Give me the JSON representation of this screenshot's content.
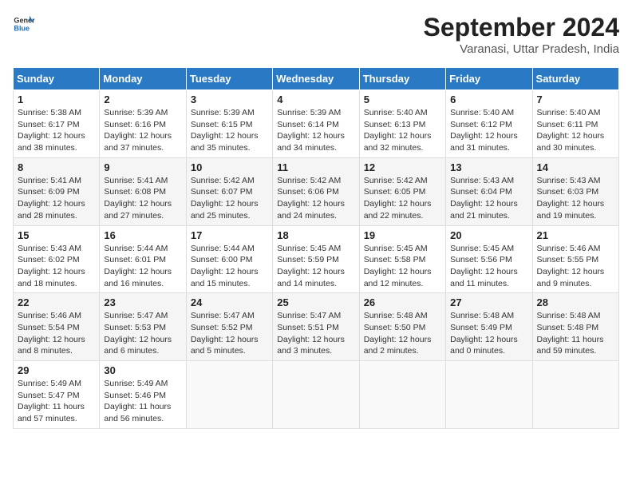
{
  "header": {
    "logo_line1": "General",
    "logo_line2": "Blue",
    "title": "September 2024",
    "subtitle": "Varanasi, Uttar Pradesh, India"
  },
  "calendar": {
    "days_of_week": [
      "Sunday",
      "Monday",
      "Tuesday",
      "Wednesday",
      "Thursday",
      "Friday",
      "Saturday"
    ],
    "weeks": [
      [
        {
          "day": "",
          "detail": ""
        },
        {
          "day": "2",
          "detail": "Sunrise: 5:39 AM\nSunset: 6:16 PM\nDaylight: 12 hours\nand 37 minutes."
        },
        {
          "day": "3",
          "detail": "Sunrise: 5:39 AM\nSunset: 6:15 PM\nDaylight: 12 hours\nand 35 minutes."
        },
        {
          "day": "4",
          "detail": "Sunrise: 5:39 AM\nSunset: 6:14 PM\nDaylight: 12 hours\nand 34 minutes."
        },
        {
          "day": "5",
          "detail": "Sunrise: 5:40 AM\nSunset: 6:13 PM\nDaylight: 12 hours\nand 32 minutes."
        },
        {
          "day": "6",
          "detail": "Sunrise: 5:40 AM\nSunset: 6:12 PM\nDaylight: 12 hours\nand 31 minutes."
        },
        {
          "day": "7",
          "detail": "Sunrise: 5:40 AM\nSunset: 6:11 PM\nDaylight: 12 hours\nand 30 minutes."
        }
      ],
      [
        {
          "day": "8",
          "detail": "Sunrise: 5:41 AM\nSunset: 6:09 PM\nDaylight: 12 hours\nand 28 minutes."
        },
        {
          "day": "9",
          "detail": "Sunrise: 5:41 AM\nSunset: 6:08 PM\nDaylight: 12 hours\nand 27 minutes."
        },
        {
          "day": "10",
          "detail": "Sunrise: 5:42 AM\nSunset: 6:07 PM\nDaylight: 12 hours\nand 25 minutes."
        },
        {
          "day": "11",
          "detail": "Sunrise: 5:42 AM\nSunset: 6:06 PM\nDaylight: 12 hours\nand 24 minutes."
        },
        {
          "day": "12",
          "detail": "Sunrise: 5:42 AM\nSunset: 6:05 PM\nDaylight: 12 hours\nand 22 minutes."
        },
        {
          "day": "13",
          "detail": "Sunrise: 5:43 AM\nSunset: 6:04 PM\nDaylight: 12 hours\nand 21 minutes."
        },
        {
          "day": "14",
          "detail": "Sunrise: 5:43 AM\nSunset: 6:03 PM\nDaylight: 12 hours\nand 19 minutes."
        }
      ],
      [
        {
          "day": "15",
          "detail": "Sunrise: 5:43 AM\nSunset: 6:02 PM\nDaylight: 12 hours\nand 18 minutes."
        },
        {
          "day": "16",
          "detail": "Sunrise: 5:44 AM\nSunset: 6:01 PM\nDaylight: 12 hours\nand 16 minutes."
        },
        {
          "day": "17",
          "detail": "Sunrise: 5:44 AM\nSunset: 6:00 PM\nDaylight: 12 hours\nand 15 minutes."
        },
        {
          "day": "18",
          "detail": "Sunrise: 5:45 AM\nSunset: 5:59 PM\nDaylight: 12 hours\nand 14 minutes."
        },
        {
          "day": "19",
          "detail": "Sunrise: 5:45 AM\nSunset: 5:58 PM\nDaylight: 12 hours\nand 12 minutes."
        },
        {
          "day": "20",
          "detail": "Sunrise: 5:45 AM\nSunset: 5:56 PM\nDaylight: 12 hours\nand 11 minutes."
        },
        {
          "day": "21",
          "detail": "Sunrise: 5:46 AM\nSunset: 5:55 PM\nDaylight: 12 hours\nand 9 minutes."
        }
      ],
      [
        {
          "day": "22",
          "detail": "Sunrise: 5:46 AM\nSunset: 5:54 PM\nDaylight: 12 hours\nand 8 minutes."
        },
        {
          "day": "23",
          "detail": "Sunrise: 5:47 AM\nSunset: 5:53 PM\nDaylight: 12 hours\nand 6 minutes."
        },
        {
          "day": "24",
          "detail": "Sunrise: 5:47 AM\nSunset: 5:52 PM\nDaylight: 12 hours\nand 5 minutes."
        },
        {
          "day": "25",
          "detail": "Sunrise: 5:47 AM\nSunset: 5:51 PM\nDaylight: 12 hours\nand 3 minutes."
        },
        {
          "day": "26",
          "detail": "Sunrise: 5:48 AM\nSunset: 5:50 PM\nDaylight: 12 hours\nand 2 minutes."
        },
        {
          "day": "27",
          "detail": "Sunrise: 5:48 AM\nSunset: 5:49 PM\nDaylight: 12 hours\nand 0 minutes."
        },
        {
          "day": "28",
          "detail": "Sunrise: 5:48 AM\nSunset: 5:48 PM\nDaylight: 11 hours\nand 59 minutes."
        }
      ],
      [
        {
          "day": "29",
          "detail": "Sunrise: 5:49 AM\nSunset: 5:47 PM\nDaylight: 11 hours\nand 57 minutes."
        },
        {
          "day": "30",
          "detail": "Sunrise: 5:49 AM\nSunset: 5:46 PM\nDaylight: 11 hours\nand 56 minutes."
        },
        {
          "day": "",
          "detail": ""
        },
        {
          "day": "",
          "detail": ""
        },
        {
          "day": "",
          "detail": ""
        },
        {
          "day": "",
          "detail": ""
        },
        {
          "day": "",
          "detail": ""
        }
      ]
    ],
    "first_row_special": {
      "day": "1",
      "detail": "Sunrise: 5:38 AM\nSunset: 6:17 PM\nDaylight: 12 hours\nand 38 minutes."
    }
  }
}
